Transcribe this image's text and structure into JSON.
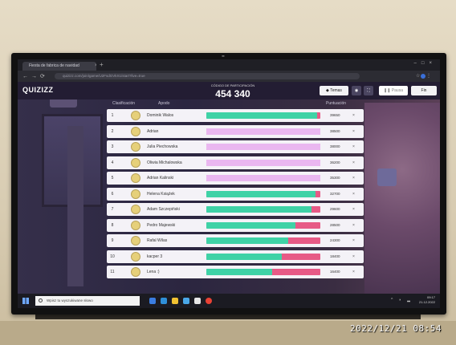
{
  "browser": {
    "tab_title": "Fiesta de fabrica de navidad",
    "url": "quizizz.com/join/game/U2FsdGVkX1/start?live=true"
  },
  "game": {
    "logo": "QUIZIZZ",
    "code_label": "CÓDIGO DE PARTICIPACIÓN",
    "code": "454 340",
    "buttons": {
      "temas": "Temas",
      "pausa": "Pausa",
      "fin": "Fin"
    },
    "columns": {
      "rank": "Clasificación",
      "name": "Apodo",
      "score": "Puntuación"
    },
    "leaderboard": [
      {
        "rank": "1",
        "name": "Dominik Walos",
        "score": "39650",
        "progress": 0.97,
        "color": "#3fd2a6"
      },
      {
        "rank": "2",
        "name": "Adrian",
        "score": "38500",
        "progress": 1.0,
        "color": "#eab7f0"
      },
      {
        "rank": "3",
        "name": "Julia Piechowska",
        "score": "38000",
        "progress": 1.0,
        "color": "#eab7f0"
      },
      {
        "rank": "4",
        "name": "Oliwia Michalowska",
        "score": "36200",
        "progress": 1.0,
        "color": "#eab7f0"
      },
      {
        "rank": "5",
        "name": "Adrian Kalinski",
        "score": "35300",
        "progress": 1.0,
        "color": "#eab7f0"
      },
      {
        "rank": "6",
        "name": "Helena Ksiąźek",
        "score": "32700",
        "progress": 0.96,
        "color": "#3fd2a6"
      },
      {
        "rank": "7",
        "name": "Adam Szczepiński",
        "score": "29600",
        "progress": 0.92,
        "color": "#3fd2a6"
      },
      {
        "rank": "8",
        "name": "Pedro Majewski",
        "score": "28500",
        "progress": 0.78,
        "color": "#3fd2a6"
      },
      {
        "rank": "9",
        "name": "Rafal Wilas",
        "score": "24300",
        "progress": 0.72,
        "color": "#3fd2a6"
      },
      {
        "rank": "10",
        "name": "kacper 3",
        "score": "18400",
        "progress": 0.66,
        "color": "#3fd2a6"
      },
      {
        "rank": "11",
        "name": "Lena :)",
        "score": "16400",
        "progress": 0.58,
        "color": "#3fd2a6"
      }
    ]
  },
  "taskbar": {
    "search_placeholder": "Wpisz tu wyszukiwane słowo",
    "time": "09:17",
    "date": "21.12.2022"
  },
  "photo_timestamp": "2022/12/21 08:54"
}
